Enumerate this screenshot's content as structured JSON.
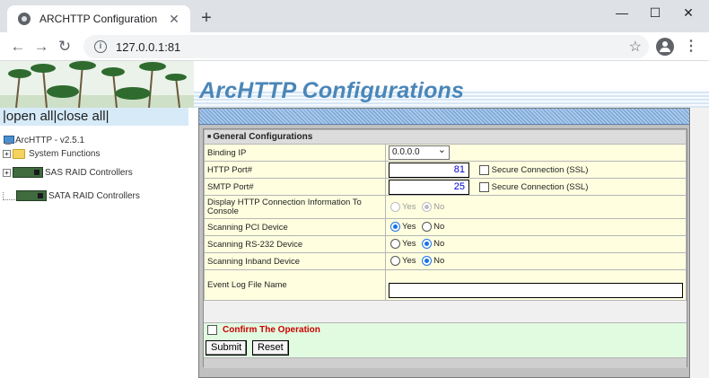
{
  "browser": {
    "tab_title": "ARCHTTP Configuration",
    "url": "127.0.0.1:81",
    "new_tab": "+",
    "tab_close": "✕",
    "back": "←",
    "forward": "→",
    "reload": "↻",
    "min": "—",
    "max": "☐",
    "close": "✕",
    "star": "☆",
    "menu": "⋮",
    "info": "i"
  },
  "banner": {
    "title": "ArcHTTP Configurations"
  },
  "left": {
    "open_all": "open all",
    "close_all": "close all",
    "sep": "|",
    "tree": {
      "root": "ArcHTTP - v2.5.1",
      "system_functions": "System Functions",
      "sas": "SAS RAID Controllers",
      "sata": "SATA RAID Controllers"
    }
  },
  "form": {
    "header": "General Configurations",
    "binding_ip_label": "Binding IP",
    "binding_ip_value": "0.0.0.0",
    "http_port_label": "HTTP Port#",
    "http_port_value": "81",
    "smtp_port_label": "SMTP Port#",
    "smtp_port_value": "25",
    "ssl_label": "Secure Connection (SSL)",
    "display_http_label": "Display HTTP Connection Information To Console",
    "scan_pci_label": "Scanning PCI Device",
    "scan_rs232_label": "Scanning RS-232 Device",
    "scan_inband_label": "Scanning Inband Device",
    "event_log_label": "Event Log File Name",
    "yes": "Yes",
    "no": "No",
    "confirm_label": "Confirm The Operation",
    "submit": "Submit",
    "reset": "Reset",
    "selections": {
      "display_http": "No",
      "display_http_disabled": true,
      "scan_pci": "Yes",
      "scan_rs232": "No",
      "scan_inband": "No"
    }
  },
  "colors": {
    "title_blue": "#4a86b8",
    "confirm_red": "#cc0000",
    "label_cell_bg": "#ffffe0",
    "confirm_bg": "#e1fbe1"
  }
}
